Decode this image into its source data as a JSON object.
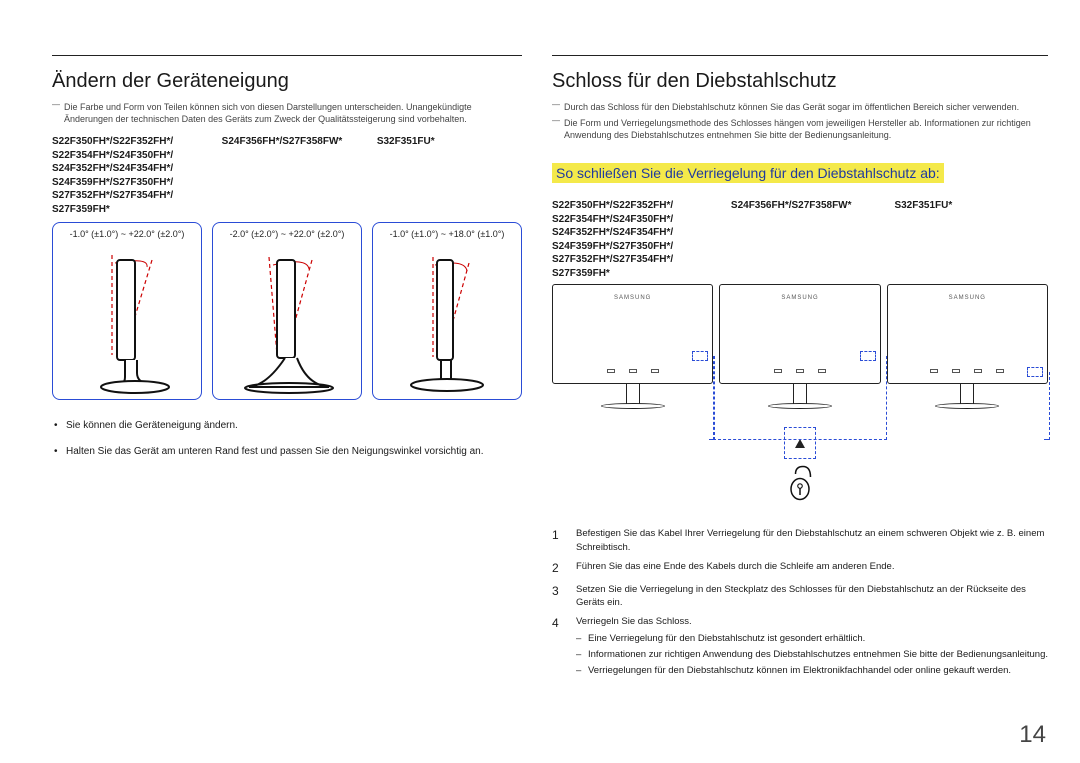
{
  "page_number": "14",
  "left": {
    "heading": "Ändern der Geräteneigung",
    "note": "Die Farbe und Form von Teilen können sich von diesen Darstellungen unterscheiden. Unangekündigte Änderungen der technischen Daten des Geräts zum Zweck der Qualitätssteigerung sind vorbehalten.",
    "models": {
      "c1": "S22F350FH*/S22F352FH*/\nS22F354FH*/S24F350FH*/\nS24F352FH*/S24F354FH*/\nS24F359FH*/S27F350FH*/\nS27F352FH*/S27F354FH*/\nS27F359FH*",
      "c2": "S24F356FH*/S27F358FW*",
      "c3": "S32F351FU*"
    },
    "tilt": {
      "s1": "-1.0° (±1.0°) ~ +22.0° (±2.0°)",
      "s2": "-2.0° (±2.0°) ~ +22.0° (±2.0°)",
      "s3": "-1.0° (±1.0°) ~ +18.0° (±1.0°)"
    },
    "bullet1": "Sie können die Geräteneigung ändern.",
    "bullet2": "Halten Sie das Gerät am unteren Rand fest und passen Sie den Neigungswinkel vorsichtig an."
  },
  "right": {
    "heading": "Schloss für den Diebstahlschutz",
    "note1": "Durch das Schloss für den Diebstahlschutz können Sie das Gerät sogar im öffentlichen Bereich sicher verwenden.",
    "note2": "Die Form und Verriegelungsmethode des Schlosses hängen vom jeweiligen Hersteller ab. Informationen zur richtigen Anwendung des Diebstahlschutzes entnehmen Sie bitte der Bedienungsanleitung.",
    "sub_heading": "So schließen Sie die Verriegelung für den Diebstahlschutz ab:",
    "models": {
      "c1": "S22F350FH*/S22F352FH*/\nS22F354FH*/S24F350FH*/\nS24F352FH*/S24F354FH*/\nS24F359FH*/S27F350FH*/\nS27F352FH*/S27F354FH*/\nS27F359FH*",
      "c2": "S24F356FH*/S27F358FW*",
      "c3": "S32F351FU*"
    },
    "brand": "SAMSUNG",
    "steps": {
      "n1": "1",
      "t1": "Befestigen Sie das Kabel Ihrer Verriegelung für den Diebstahlschutz an einem schweren Objekt wie z. B. einem Schreibtisch.",
      "n2": "2",
      "t2": "Führen Sie das eine Ende des Kabels durch die Schleife am anderen Ende.",
      "n3": "3",
      "t3": "Setzen Sie die Verriegelung in den Steckplatz des Schlosses für den Diebstahlschutz an der Rückseite des Geräts ein.",
      "n4": "4",
      "t4": "Verriegeln Sie das Schloss.",
      "d1": "Eine Verriegelung für den Diebstahlschutz ist gesondert erhältlich.",
      "d2": "Informationen zur richtigen Anwendung des Diebstahlschutzes entnehmen Sie bitte der Bedienungsanleitung.",
      "d3": "Verriegelungen für den Diebstahlschutz können im Elektronikfachhandel oder online gekauft werden."
    }
  }
}
